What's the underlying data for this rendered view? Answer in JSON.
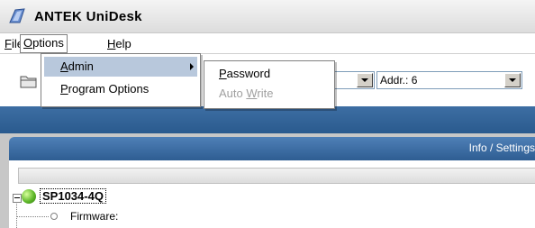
{
  "window": {
    "title": "ANTEK  UniDesk"
  },
  "menubar": {
    "items": [
      {
        "key": "F",
        "rest": "ile"
      },
      {
        "key": "O",
        "rest": "ptions"
      },
      {
        "key": "H",
        "rest": "elp"
      }
    ]
  },
  "options_menu": {
    "items": [
      {
        "key": "A",
        "rest": "dmin"
      },
      {
        "key": "P",
        "rest": "rogram Options"
      }
    ]
  },
  "admin_submenu": {
    "password": {
      "key": "P",
      "rest": "assword"
    },
    "auto_write": {
      "pre": "Auto ",
      "key": "W",
      "rest": "rite"
    }
  },
  "toolbar": {
    "combo_left": "",
    "address": "Addr.: 6"
  },
  "panel": {
    "title": "Info / Settings"
  },
  "tree": {
    "device_name": "SP1034-4Q",
    "firmware_label": "Firmware:"
  },
  "colors": {
    "accent": "#2e5d92",
    "status_online": "#5fb82a"
  },
  "icons": [
    "app-logo-icon",
    "folder-icon",
    "chevron-down-icon",
    "chevron-right-icon",
    "status-online-icon"
  ]
}
